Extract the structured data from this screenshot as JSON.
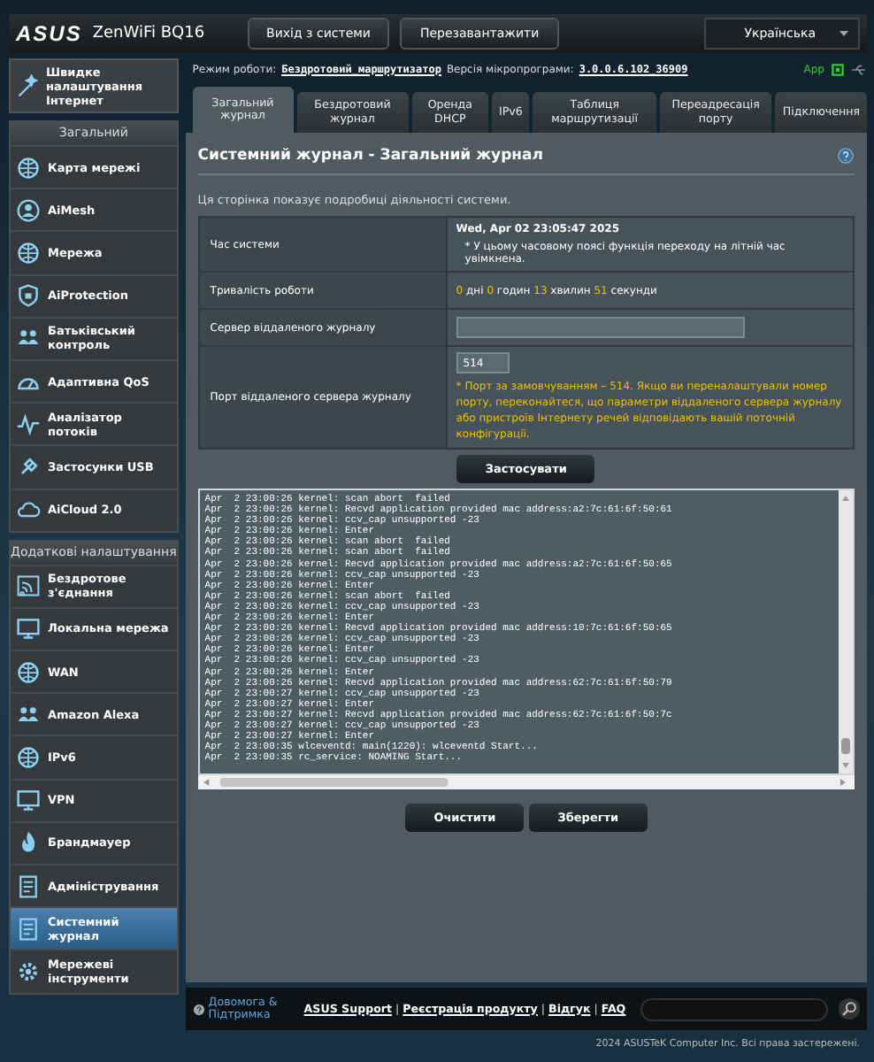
{
  "header": {
    "logo": "ASUS",
    "model": "ZenWiFi BQ16",
    "buttons": [
      "Вихід з системи",
      "Перезавантажити"
    ],
    "language": "Українська"
  },
  "status_line": {
    "mode_label": "Режим роботи:",
    "mode": "Бездротовий_маршрутизатор",
    "firmware_label": "Версія мікропрограми:",
    "firmware": "3.0.0.6.102_36909",
    "app": "App"
  },
  "sidebar": {
    "quick_setup": "Швидке налаштування Інтернет",
    "sections": [
      {
        "title": "Загальний",
        "items": [
          {
            "label": "Карта мережі",
            "selected": false
          },
          {
            "label": "AiMesh",
            "selected": false
          },
          {
            "label": "Мережа",
            "selected": false
          },
          {
            "label": "AiProtection",
            "selected": false
          },
          {
            "label": "Батьківський контроль",
            "selected": false
          },
          {
            "label": "Адаптивна QoS",
            "selected": false
          },
          {
            "label": "Аналізатор потоків",
            "selected": false
          },
          {
            "label": "Застосунки USB",
            "selected": false
          },
          {
            "label": "AiCloud 2.0",
            "selected": false
          }
        ]
      },
      {
        "title": "Додаткові налаштування",
        "items": [
          {
            "label": "Бездротове з'єднання",
            "selected": false
          },
          {
            "label": "Локальна мережа",
            "selected": false
          },
          {
            "label": "WAN",
            "selected": false
          },
          {
            "label": "Amazon Alexa",
            "selected": false
          },
          {
            "label": "IPv6",
            "selected": false
          },
          {
            "label": "VPN",
            "selected": false
          },
          {
            "label": "Брандмауер",
            "selected": false
          },
          {
            "label": "Адміністрування",
            "selected": false
          },
          {
            "label": "Системний журнал",
            "selected": true
          },
          {
            "label": "Мережеві інструменти",
            "selected": false
          }
        ]
      }
    ]
  },
  "tabs": [
    {
      "label": "Загальний журнал",
      "selected": true
    },
    {
      "label": "Бездротовий журнал",
      "selected": false
    },
    {
      "label": "Оренда DHCP",
      "selected": false
    },
    {
      "label": "IPv6",
      "selected": false
    },
    {
      "label": "Таблиця маршрутизації",
      "selected": false
    },
    {
      "label": "Переадресація порту",
      "selected": false
    },
    {
      "label": "Підключення",
      "selected": false
    }
  ],
  "panel": {
    "title": "Системний журнал - Загальний журнал",
    "description": "Ця сторінка показує подробиці діяльності системи.",
    "rows": [
      {
        "kind": "time",
        "label": "Час системи",
        "value": "Wed, Apr 02 23:05:47 2025",
        "note": "* У цьому часовому поясі функція переходу на літній час увімкнена."
      },
      {
        "kind": "uptime",
        "label": "Тривалість роботи",
        "parts": [
          {
            "value": "0",
            "unit": "дні"
          },
          {
            "value": "0",
            "unit": "годин"
          },
          {
            "value": "13",
            "unit": "хвилин"
          },
          {
            "value": "51",
            "unit": "секунди"
          }
        ]
      },
      {
        "kind": "field",
        "label": "Сервер віддаленого журналу"
      },
      {
        "kind": "port",
        "label": "Порт віддаленого сервера журналу",
        "value": "514",
        "note": "* Порт за замовчуванням – 514. Якщо ви переналаштували номер порту, переконайтеся, що параметри віддаленого сервера журналу або пристроїв Інтернету речей відповідають вашій поточній конфігурації."
      }
    ],
    "apply": "Застосувати",
    "log": [
      "Apr  2 23:00:26 kernel: scan abort  failed",
      "Apr  2 23:00:26 kernel: Recvd application provided mac address:a2:7c:61:6f:50:61",
      "Apr  2 23:00:26 kernel: ccv_cap unsupported -23",
      "Apr  2 23:00:26 kernel: Enter",
      "Apr  2 23:00:26 kernel: scan abort  failed",
      "Apr  2 23:00:26 kernel: scan abort  failed",
      "Apr  2 23:00:26 kernel: Recvd application provided mac address:a2:7c:61:6f:50:65",
      "Apr  2 23:00:26 kernel: ccv_cap unsupported -23",
      "Apr  2 23:00:26 kernel: Enter",
      "Apr  2 23:00:26 kernel: scan abort  failed",
      "Apr  2 23:00:26 kernel: ccv_cap unsupported -23",
      "Apr  2 23:00:26 kernel: Enter",
      "Apr  2 23:00:26 kernel: Recvd application provided mac address:10:7c:61:6f:50:65",
      "Apr  2 23:00:26 kernel: ccv_cap unsupported -23",
      "Apr  2 23:00:26 kernel: Enter",
      "Apr  2 23:00:26 kernel: ccv_cap unsupported -23",
      "Apr  2 23:00:26 kernel: Enter",
      "Apr  2 23:00:26 kernel: Recvd application provided mac address:62:7c:61:6f:50:79",
      "Apr  2 23:00:27 kernel: ccv_cap unsupported -23",
      "Apr  2 23:00:27 kernel: Enter",
      "Apr  2 23:00:27 kernel: Recvd application provided mac address:62:7c:61:6f:50:7c",
      "Apr  2 23:00:27 kernel: ccv_cap unsupported -23",
      "Apr  2 23:00:27 kernel: Enter",
      "Apr  2 23:00:35 wlceventd: main(1220): wlceventd Start...",
      "Apr  2 23:00:35 rc_service: NOAMING Start..."
    ],
    "actions": [
      "Очистити",
      "Зберегти"
    ]
  },
  "footer": {
    "help": "Довомога & Підтримка",
    "links": [
      "ASUS Support",
      "Реєстрація продукту",
      "Відгук",
      "FAQ"
    ],
    "separator": "|",
    "copyright": "2024 ASUSTeK Computer Inc. Всі права застережені."
  }
}
